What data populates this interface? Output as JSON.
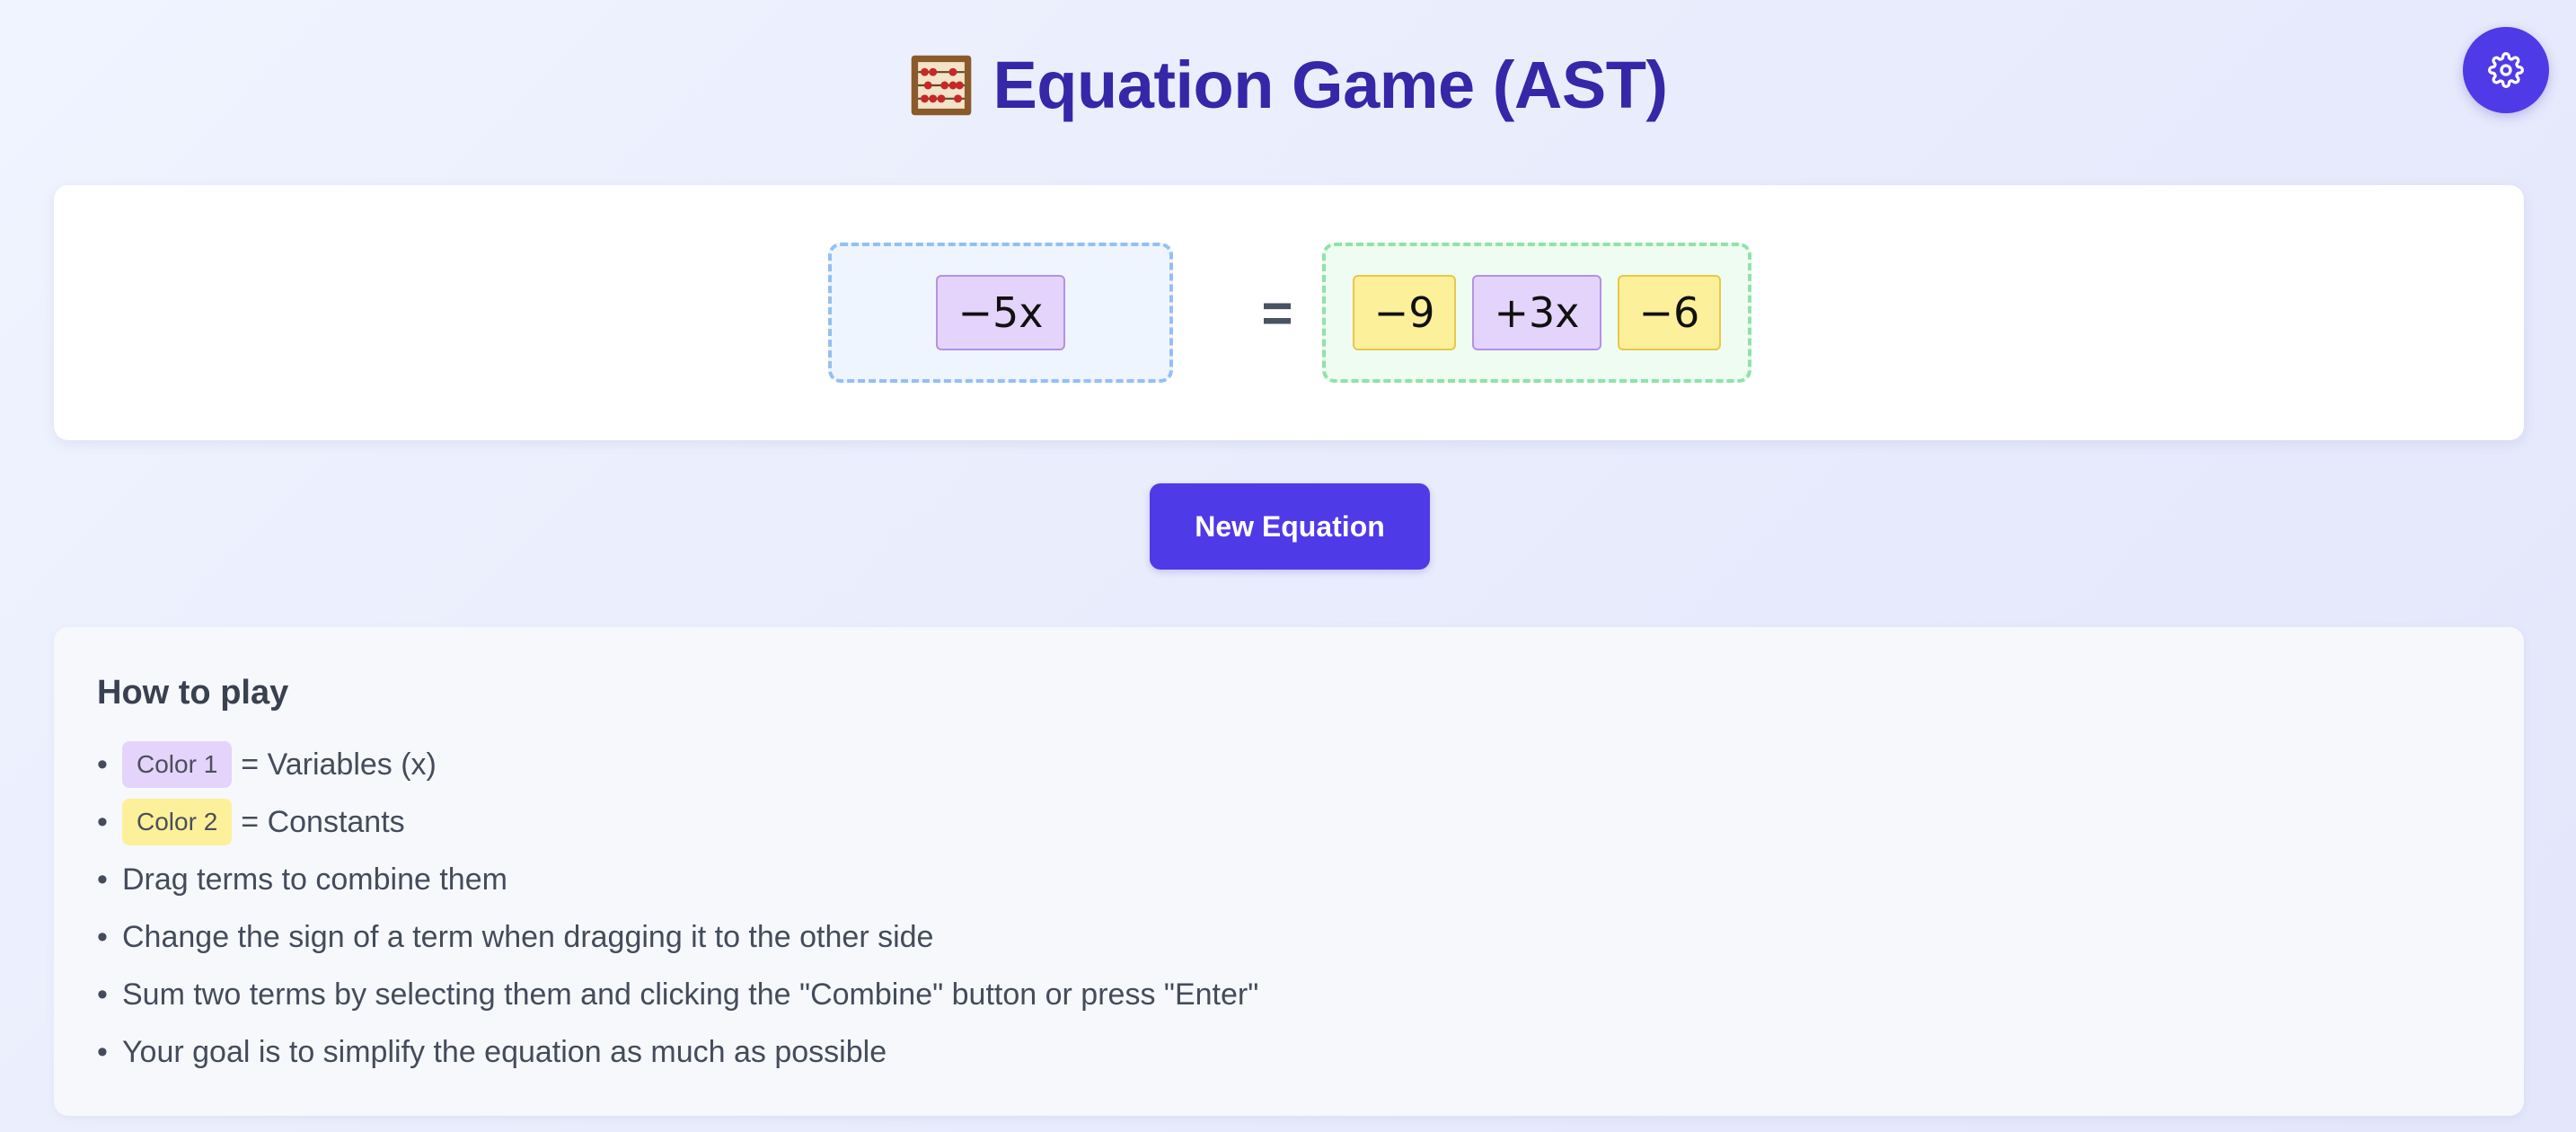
{
  "header": {
    "title": "Equation Game (AST)",
    "title_icon": "abacus-icon"
  },
  "settings": {
    "icon": "gear-icon"
  },
  "equation": {
    "left": [
      {
        "text": "−5x",
        "kind": "variable"
      }
    ],
    "equals": "=",
    "right": [
      {
        "text": "−9",
        "kind": "constant"
      },
      {
        "text": "+3x",
        "kind": "variable"
      },
      {
        "text": "−6",
        "kind": "constant"
      }
    ]
  },
  "actions": {
    "new_equation_label": "New Equation"
  },
  "how_to_play": {
    "title": "How to play",
    "color1_chip": "Color 1",
    "color1_text": "= Variables (x)",
    "color2_chip": "Color 2",
    "color2_text": "= Constants",
    "items": [
      "Drag terms to combine them",
      "Change the sign of a term when dragging it to the other side",
      "Sum two terms by selecting them and clicking the \"Combine\" button or press \"Enter\"",
      "Your goal is to simplify the equation as much as possible"
    ]
  },
  "colors": {
    "accent": "#4f3ae8",
    "title": "#3428a8",
    "variable_term": "#e4d4fb",
    "constant_term": "#fdf09a",
    "left_side_border": "#93c0f3",
    "right_side_border": "#8fe3a8"
  }
}
